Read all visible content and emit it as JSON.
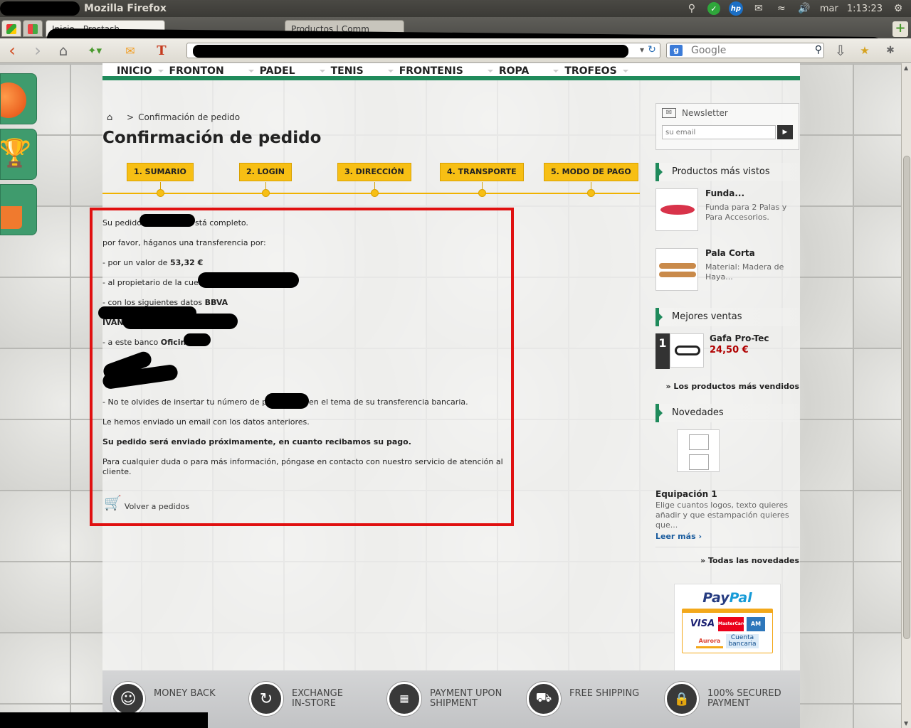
{
  "os": {
    "app_title": "Mozilla Firefox",
    "clock_day": "mar",
    "clock_time": "1:13:23"
  },
  "browser": {
    "tabs": [
      {
        "label": "Inicio - Prestash",
        "active": true
      },
      {
        "label": "Productos | Comm",
        "active": false
      }
    ],
    "search_placeholder": "Google",
    "search_engine_icon": "google-icon",
    "icons": [
      "back-icon",
      "forward-icon",
      "home-icon",
      "bookmark-icon",
      "download-icon",
      "reload-icon"
    ]
  },
  "shop": {
    "menu": [
      "INICIO",
      "FRONTON",
      "PADEL",
      "TENIS",
      "FRONTENIS",
      "ROPA",
      "TROFEOS"
    ],
    "breadcrumb_current": "Confirmación de pedido",
    "page_title": "Confirmación de pedido",
    "steps": [
      "1. SUMARIO",
      "2. LOGIN",
      "3. DIRECCIÓN",
      "4. TRANSPORTE",
      "5. MODO DE PAGO"
    ],
    "confirmation": {
      "line1_prefix": "Su pedido",
      "line1_suffix": "stá completo.",
      "line2": "por favor, háganos una transferencia por:",
      "amount_prefix": "- por un valor de ",
      "amount": "53,32 €",
      "owner_prefix": "- al propietario de la cuenta",
      "data_prefix": "- con los siguientes datos ",
      "bank_name": "BBVA",
      "iban_label": "IVAN:",
      "branch_prefix": "- a este banco ",
      "branch_label": "Oficina",
      "reminder_prefix": "- No te olvides de insertar tu número de pedido",
      "reminder_suffix": "en el tema de su transferencia bancaria.",
      "email_sent": "Le hemos enviado un email con los datos anteriores.",
      "shipping_note": "Su pedido será enviado próximamente, en cuanto recibamos su pago.",
      "contact_note": "Para cualquier duda o para más información, póngase en contacto con nuestro servicio de atención al cliente.",
      "back_link": "Volver a pedidos"
    },
    "newsletter": {
      "title": "Newsletter",
      "placeholder": "su email"
    },
    "most_viewed": {
      "title": "Productos más vistos",
      "items": [
        {
          "name": "Funda...",
          "desc": "Funda para 2 Palas y Para Accesorios."
        },
        {
          "name": "Pala Corta",
          "desc": "Material: Madera de Haya..."
        }
      ]
    },
    "best_sellers": {
      "title": "Mejores ventas",
      "items": [
        {
          "rank": "1",
          "name": "Gafa Pro-Tec",
          "price": "24,50 €"
        }
      ],
      "more_link": "» Los productos más vendidos"
    },
    "new_products": {
      "title": "Novedades",
      "item_name": "Equipación 1",
      "item_desc": "Elige cuantos logos, texto quieres añadir y que estampación quieres que...",
      "read_more": "Leer más",
      "all_link": "» Todas las novedades"
    },
    "paypal": {
      "logo_a": "Pay",
      "logo_b": "Pal",
      "card_visa": "VISA",
      "card_mastercard": "MasterCard",
      "card_aurora": "Aurora",
      "card_cuenta": "Cuenta bancaria"
    },
    "footer": [
      {
        "icon": "smile-icon",
        "label": "MONEY BACK"
      },
      {
        "icon": "refresh-icon",
        "label": "EXCHANGE IN-STORE"
      },
      {
        "icon": "cash-icon",
        "label": "PAYMENT UPON SHIPMENT"
      },
      {
        "icon": "truck-icon",
        "label": "FREE SHIPPING"
      },
      {
        "icon": "lock-icon",
        "label": "100% SECURED PAYMENT"
      }
    ]
  },
  "colors": {
    "accent_green": "#1f8a5b",
    "step_yellow": "#f7bf14",
    "price_red": "#b00000",
    "highlight_box": "#e01010"
  }
}
